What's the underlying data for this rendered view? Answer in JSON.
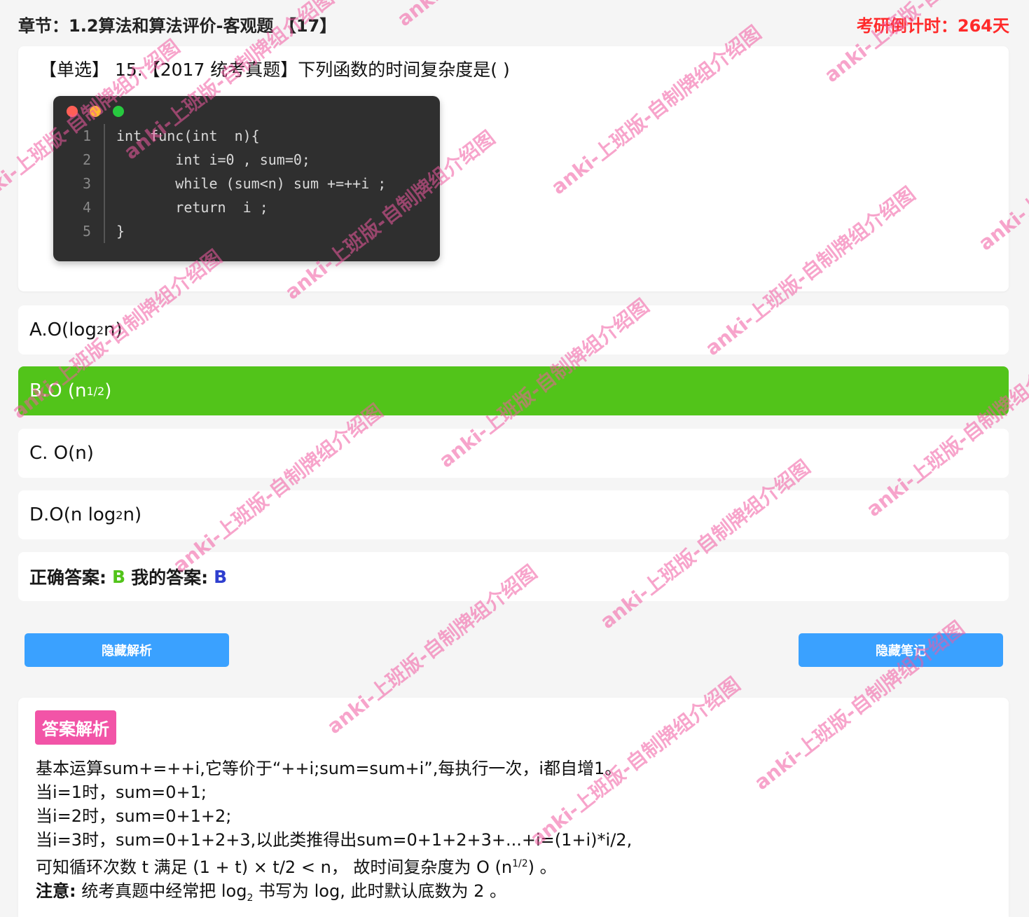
{
  "header": {
    "chapter": "章节：1.2算法和算法评价-客观题 【17】",
    "countdown": "考研倒计时：264天"
  },
  "question": {
    "type_tag": "【单选】",
    "text": "15.【2017 统考真题】下列函数的时间复杂度是( )",
    "code_lines": [
      {
        "no": "1",
        "text": "int func(int  n){"
      },
      {
        "no": "2",
        "text": "       int i=0 , sum=0;"
      },
      {
        "no": "3",
        "text": "       while (sum<n) sum +=++i ;"
      },
      {
        "no": "4",
        "text": "       return  i ;"
      },
      {
        "no": "5",
        "text": "}"
      }
    ]
  },
  "options": {
    "a": {
      "prefix": "A.O(log",
      "sub": "2",
      "suffix": " n)"
    },
    "b": {
      "prefix": "B.O (n",
      "sup": "1/2",
      "suffix": ")"
    },
    "c": {
      "text": "C. O(n)"
    },
    "d": {
      "prefix": "D.O(n log",
      "sub": "2",
      "suffix": " n)"
    }
  },
  "answer": {
    "correct_label": "正确答案:",
    "correct_value": "B",
    "mine_label": "我的答案:",
    "mine_value": "B"
  },
  "buttons": {
    "hide_analysis": "隐藏解析",
    "hide_notes": "隐藏笔记"
  },
  "analysis": {
    "tag": "答案解析",
    "line1": "基本运算sum+=++i,它等价于“++i;sum=sum+i”,每执行一次，i都自增1。",
    "line2": "当i=1时，sum=0+1;",
    "line3": "当i=2时，sum=0+1+2;",
    "line4": "当i=3时，sum=0+1+2+3,以此类推得出sum=0+1+2+3+...+i=(1+i)*i/2,",
    "line5_prefix": "可知循环次数 t 满足 (1 + t) × t/2 < n， 故时间复杂度为 O (n",
    "line5_sup": "1/2",
    "line5_suffix": ") 。",
    "note_label": "注意:",
    "note_prefix": " 统考真题中经常把 log",
    "note_sub": "2",
    "note_suffix": " 书写为 log, 此时默认底数为 2 。"
  },
  "watermark": {
    "text": "anki-上班版-自制牌组介绍图"
  },
  "colors": {
    "correct_green": "#52c41a",
    "button_blue": "#3aa1ff",
    "tag_pink": "#f254a7",
    "countdown_red": "#ff2a2a",
    "my_answer_blue": "#2f3fcf"
  }
}
